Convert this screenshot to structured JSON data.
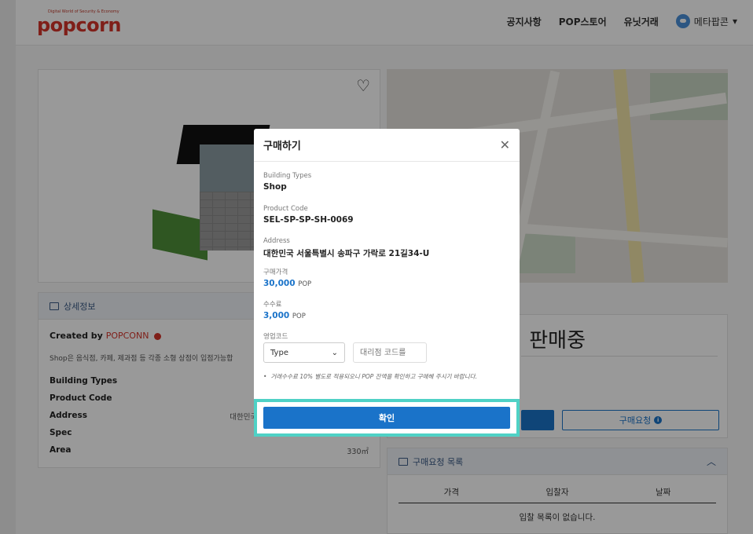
{
  "header": {
    "logo_tagline": "Digital World of Security & Economy",
    "logo_text": "popcorn",
    "nav": [
      "공지사항",
      "POP스토어",
      "유닛거래"
    ],
    "user_name": "메타팝콘",
    "user_chevron": "▾"
  },
  "viewer": {
    "favorite_icon": "heart-outline-icon",
    "favorite_glyph": "♡"
  },
  "info": {
    "title": "상세정보",
    "created_by_label": "Created by",
    "creator": "POPCONN",
    "description": "Shop은 음식점, 카페, 제과점 등 각종 소형 상점이 입점가능합",
    "rows": [
      {
        "label": "Building Types",
        "value": ""
      },
      {
        "label": "Product Code",
        "value": ""
      },
      {
        "label": "Address",
        "value": "대한민국 서"
      },
      {
        "label": "Spec",
        "value": ""
      },
      {
        "label": "Area",
        "value": "330㎡"
      }
    ]
  },
  "sale": {
    "status": "판매중",
    "request_button": "구매요청",
    "info_glyph": "i"
  },
  "requests": {
    "title": "구매요청 목록",
    "chevron_glyph": "︿",
    "columns": [
      "가격",
      "입찰자",
      "날짜"
    ],
    "empty": "입찰 목록이 없습니다."
  },
  "modal": {
    "title": "구매하기",
    "close_glyph": "✕",
    "building_type_label": "Building Types",
    "building_type_value": "Shop",
    "product_code_label": "Product Code",
    "product_code_value": "SEL-SP-SP-SH-0069",
    "address_label": "Address",
    "address_value": "대한민국 서울특별시 송파구 가락로 21길34-U",
    "price_label": "구매가격",
    "price_value": "30,000",
    "fee_label": "수수료",
    "fee_value": "3,000",
    "currency": "POP",
    "sales_code_label": "영업코드",
    "type_select_value": "Type",
    "select_chevron": "⌄",
    "agent_code_placeholder": "대리점 코드를",
    "note": "거래수수료 10% 별도로 적용되오니 POP 잔액을 확인하고 구매해 주시기 바랍니다.",
    "confirm_label": "확인"
  },
  "colors": {
    "brand": "#d4342a",
    "primary": "#1a73c9",
    "highlight": "#4fd1c5"
  }
}
